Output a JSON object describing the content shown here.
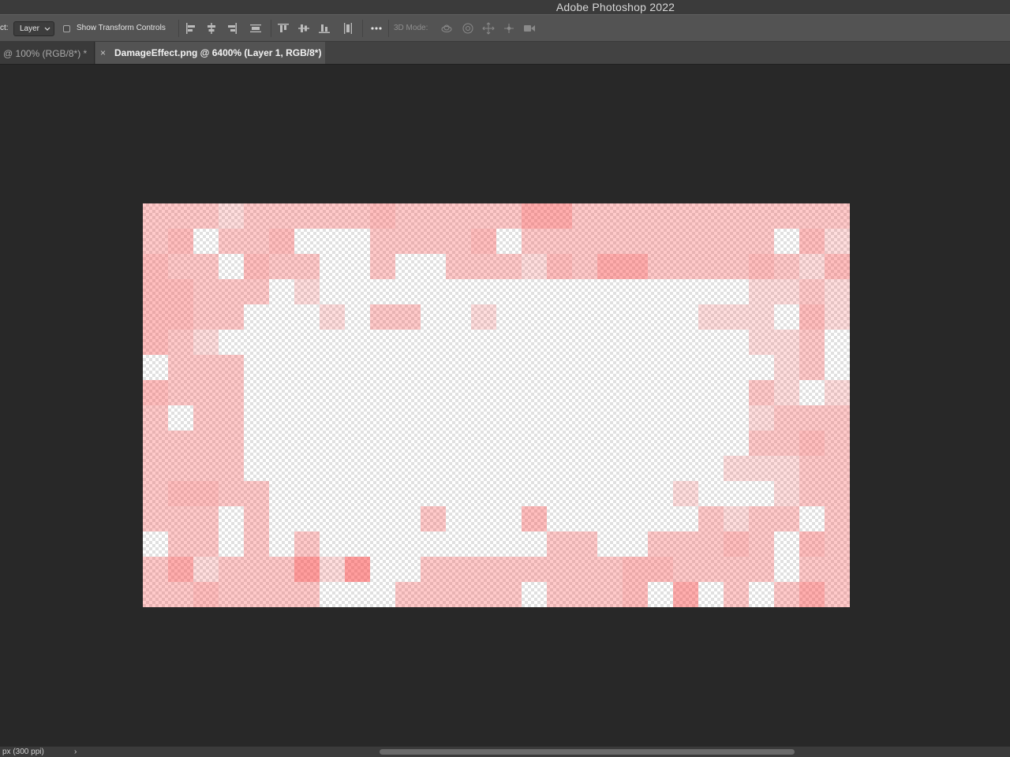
{
  "app": {
    "title": "Adobe Photoshop 2022"
  },
  "options_bar": {
    "auto_select_label": "ct:",
    "auto_select_value": "Layer",
    "show_transform_controls_label": "Show Transform Controls",
    "show_transform_controls_checked": false,
    "mode_3d_label": "3D Mode:"
  },
  "tabs": [
    {
      "label": "@ 100% (RGB/8*) *",
      "active": false
    },
    {
      "label": "DamageEffect.png @ 6400% (Layer 1, RGB/8*)",
      "active": true,
      "close_glyph": "×"
    }
  ],
  "document": {
    "grid_columns": 28,
    "grid_rows": 16,
    "pixel_color": "#ff3b3b",
    "pixels": [
      "2221222223222224422222222222",
      "2302230002222302222222222031",
      "3220322002002221324422223213",
      "3322201000000000000000001121",
      "3322000102200100000000111031",
      "3210000000000000000000001120",
      "0222000000000000000000000120",
      "3222000000000000000000002101",
      "2022000000000000000000001222",
      "2222000000000000000000002232",
      "2222000000000000000000011122",
      "2332200000000000000001000122",
      "2220200000020003000000212202",
      "0220202000000000220022232032",
      "2412225150022222222332222022",
      "2232222000222220222304020242"
    ]
  },
  "status_bar": {
    "text": "px (300 ppi)",
    "arrow": "›"
  },
  "theme": {
    "accent_red": "#ff3b3b",
    "canvas_bg": "#282828"
  }
}
